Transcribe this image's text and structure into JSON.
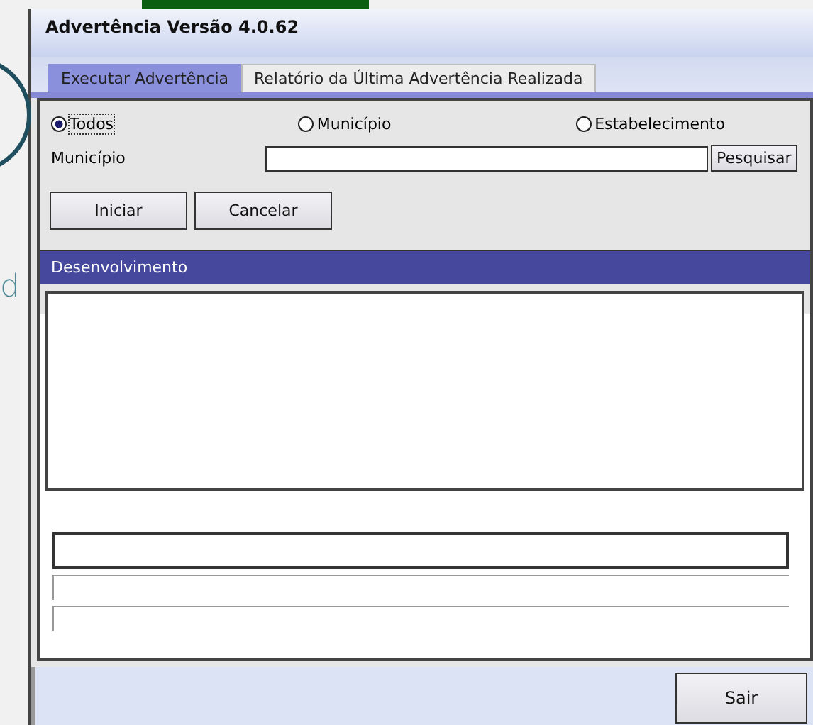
{
  "background": {
    "text_fragment": "d"
  },
  "window": {
    "title": "Advertência Versão 4.0.62"
  },
  "tabs": [
    {
      "label": "Executar Advertência",
      "selected": true
    },
    {
      "label": "Relatório da Última Advertência Realizada",
      "selected": false
    }
  ],
  "scope_options": [
    {
      "label": "Todos",
      "selected": true
    },
    {
      "label": "Município",
      "selected": false
    },
    {
      "label": "Estabelecimento",
      "selected": false
    }
  ],
  "search": {
    "label": "Município",
    "button": "Pesquisar"
  },
  "actions": [
    "Iniciar",
    "Cancelar"
  ],
  "progress_panel": {
    "title": "Desenvolvimento"
  },
  "footer_button": "Sair"
}
